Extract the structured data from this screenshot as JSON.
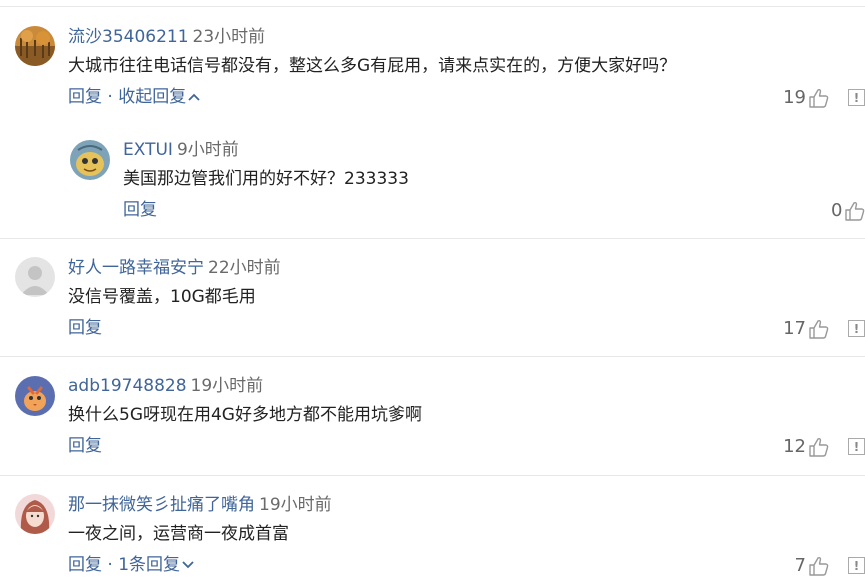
{
  "comments": [
    {
      "user": "流沙35406211",
      "time": "23小时前",
      "text": "大城市往往电话信号都没有，整这么多G有屁用，请来点实在的，方便大家好吗？",
      "reply": "回复",
      "sep": "·",
      "toggle": "收起回复",
      "likes": "19",
      "reply_item": {
        "user": "EXTUI",
        "time": "9小时前",
        "text": "美国那边管我们用的好不好？233333",
        "reply": "回复",
        "likes": "0"
      }
    },
    {
      "user": "好人一路幸福安宁",
      "time": "22小时前",
      "text": "没信号覆盖，10G都毛用",
      "reply": "回复",
      "likes": "17"
    },
    {
      "user": "adb19748828",
      "time": "19小时前",
      "text": "换什么5G呀现在用4G好多地方都不能用坑爹啊",
      "reply": "回复",
      "likes": "12"
    },
    {
      "user": "那一抹微笑彡扯痛了嘴角",
      "time": "19小时前",
      "text": "一夜之间，运营商一夜成首富",
      "reply": "回复",
      "sep": "·",
      "toggle": "1条回复",
      "likes": "7"
    }
  ],
  "icons": {
    "like": "thumbs-up-icon",
    "report": "report-icon",
    "expand": "chevron-down-icon",
    "collapse": "chevron-up-icon"
  },
  "colors": {
    "username": "#406599",
    "action": "#406599",
    "text": "#222222",
    "time": "#6a6a6a",
    "likes": "#666666"
  }
}
